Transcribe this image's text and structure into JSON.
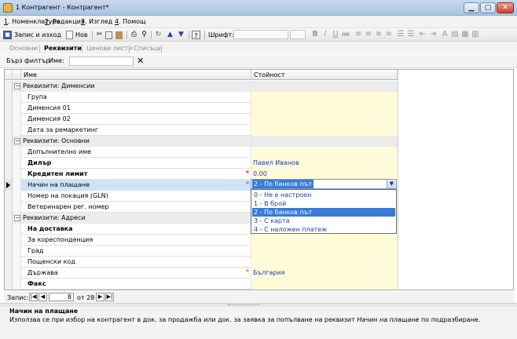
{
  "window": {
    "title": "1 Контрагент - Контрагент*",
    "min": "▁",
    "max": "▢",
    "close": "✕"
  },
  "menu": [
    {
      "num": "1",
      "label": ". Номенклатура"
    },
    {
      "num": "2",
      "label": ". Редакция"
    },
    {
      "num": "3",
      "label": ". Изглед"
    },
    {
      "num": "4",
      "label": ". Помощ"
    }
  ],
  "toolbar": {
    "save_exit": "Запис и изход",
    "new": "Нов",
    "font_label": "Шрифт:",
    "bold": "B",
    "italic": "I",
    "underline": "U",
    "strike": "ab"
  },
  "tabs": [
    "Основни",
    "Реквизити",
    "Ценови листи",
    "Списъци"
  ],
  "active_tab": "Реквизити",
  "filter": {
    "quick_filter": "Бърз филтър",
    "field": "Име:",
    "clear": "✕"
  },
  "grid": {
    "headers": {
      "name": "Име",
      "value": "Стойност"
    },
    "groups": {
      "dimensions": "Реквизити: Дименсии",
      "basic": "Реквизити: Основни",
      "addresses": "Реквизити: Адреси"
    },
    "rows": [
      {
        "name": "Група",
        "value": ""
      },
      {
        "name": "Дименсия 01",
        "value": ""
      },
      {
        "name": "Дименсия 02",
        "value": ""
      },
      {
        "name": "Дата за ремаркетинг",
        "value": ""
      },
      {
        "name": "Допълнително име",
        "value": ""
      },
      {
        "name": "Дилър",
        "value": "Павел Иванов"
      },
      {
        "name": "Кредитен лимит",
        "value": "0.00",
        "req": "*"
      },
      {
        "name": "Начин на плащане",
        "value": "",
        "req": "*"
      },
      {
        "name": "Номер на локация (GLN)",
        "value": ""
      },
      {
        "name": "Ветеринарен рег. номер",
        "value": ""
      },
      {
        "name": "На доставка",
        "value": ""
      },
      {
        "name": "За кореспонденция",
        "value": ""
      },
      {
        "name": "Град",
        "value": ""
      },
      {
        "name": "Пощенски код",
        "value": ""
      },
      {
        "name": "Държава",
        "value": "България",
        "req": "*"
      },
      {
        "name": "Факс",
        "value": ""
      }
    ],
    "editor_value": "2 - По банков път",
    "dropdown_options": [
      "0 - Не е настроен",
      "1 - В брой",
      "2 - По банков път",
      "3 - С карта",
      "4 - С наложен платеж"
    ],
    "selected_option_index": 2
  },
  "navigator": {
    "label": "Запис:",
    "current": "8",
    "of": "от 28"
  },
  "description": {
    "title": "Начин на плащане",
    "text_before": "Използва се при избор на контрагент в док. за продажба или док. за заявка за попълване на реквизит ",
    "text_italic": "Начин на плащане",
    "text_after": " по подразбиране."
  }
}
